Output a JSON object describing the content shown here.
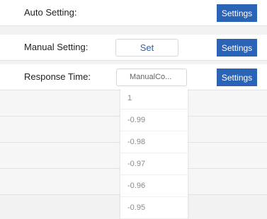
{
  "rows": {
    "auto": {
      "label": "Auto Setting:",
      "button": "Settings"
    },
    "manual": {
      "label": "Manual Setting:",
      "set_button": "Set",
      "button": "Settings"
    },
    "response": {
      "label": "Response Time:",
      "select_value": "ManualCo...",
      "button": "Settings"
    }
  },
  "dropdown": {
    "options": [
      "1",
      "-0.99",
      "-0.98",
      "-0.97",
      "-0.96",
      "-0.95"
    ]
  },
  "colors": {
    "accent": "#2b63b6",
    "row_bg": "#ffffff",
    "page_bg": "#f2f2f2"
  }
}
